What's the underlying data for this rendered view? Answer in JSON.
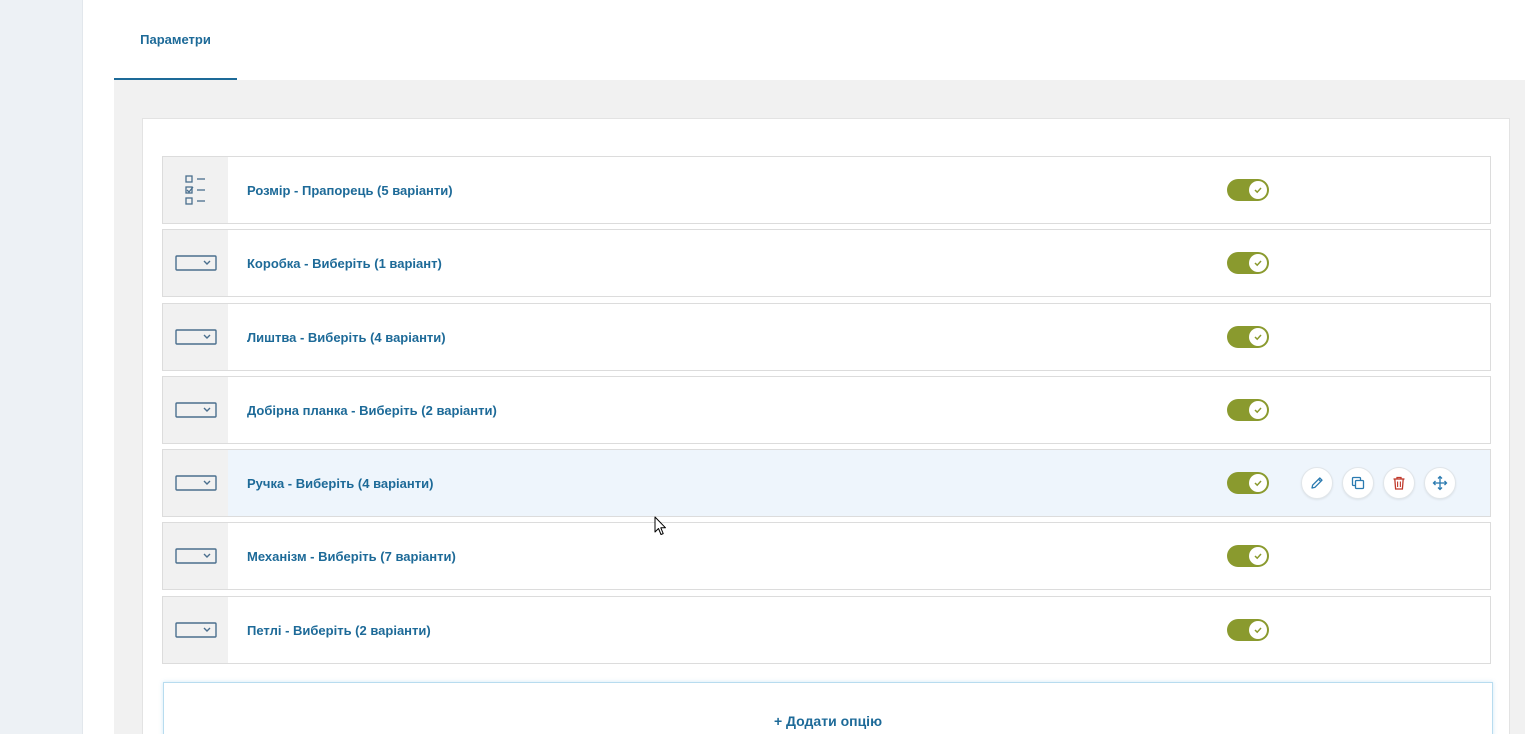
{
  "tabs": [
    {
      "label": "Параметри",
      "active": true
    }
  ],
  "options": [
    {
      "label": "Розмір - Прапорець (5 варіанти)",
      "type_icon": "checklist-icon",
      "enabled": true
    },
    {
      "label": "Коробка - Виберіть (1 варіант)",
      "type_icon": "select-dropdown-icon",
      "enabled": true
    },
    {
      "label": "Лиштва - Виберіть (4 варіанти)",
      "type_icon": "select-dropdown-icon",
      "enabled": true
    },
    {
      "label": "Добірна планка - Виберіть (2 варіанти)",
      "type_icon": "select-dropdown-icon",
      "enabled": true
    },
    {
      "label": "Ручка - Виберіть (4 варіанти)",
      "type_icon": "select-dropdown-icon",
      "enabled": true,
      "hovered": true
    },
    {
      "label": "Механізм - Виберіть (7 варіанти)",
      "type_icon": "select-dropdown-icon",
      "enabled": true
    },
    {
      "label": "Петлі - Виберіть (2 варіанти)",
      "type_icon": "select-dropdown-icon",
      "enabled": true
    }
  ],
  "row_actions": [
    "edit-icon",
    "copy-icon",
    "trash-icon",
    "move-icon"
  ],
  "add_option_label": "+ Додати опцію",
  "colors": {
    "accent": "#1d6a98",
    "toggle_on": "#8a9a2e",
    "delete": "#c0392b",
    "row_hover": "#eef5fc"
  }
}
